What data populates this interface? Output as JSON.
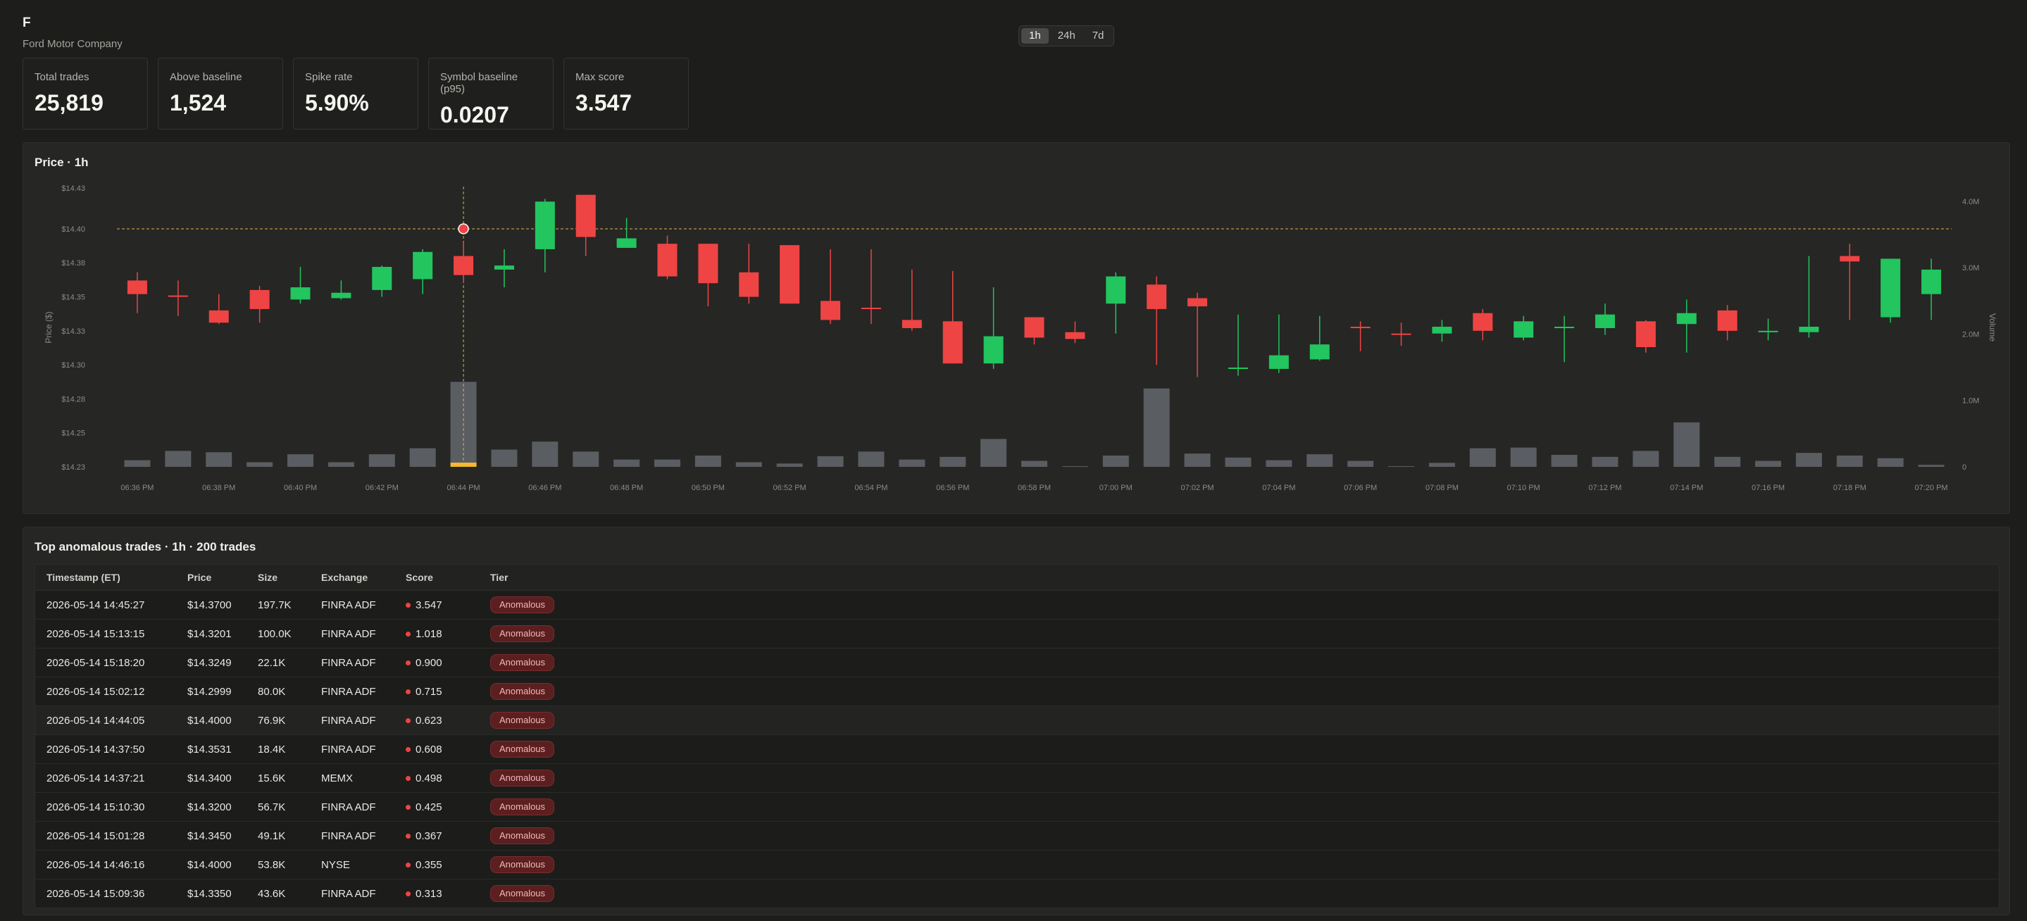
{
  "header": {
    "ticker": "F",
    "company": "Ford Motor Company"
  },
  "range_toggle": {
    "options": [
      "1h",
      "24h",
      "7d"
    ],
    "active": "1h"
  },
  "stats": [
    {
      "label": "Total trades",
      "value": "25,819"
    },
    {
      "label": "Above baseline",
      "value": "1,524"
    },
    {
      "label": "Spike rate",
      "value": "5.90%"
    },
    {
      "label": "Symbol baseline (p95)",
      "value": "0.0207"
    },
    {
      "label": "Max score",
      "value": "3.547"
    }
  ],
  "price_panel": {
    "title": "Price · 1h"
  },
  "table_panel": {
    "title": "Top anomalous trades · 1h · 200 trades"
  },
  "colors": {
    "up": "#22c55e",
    "down": "#ef4444",
    "volume": "#5a5d62",
    "highlight": "#f5b82e",
    "accent_line": "#e3b34a"
  },
  "chart_data": {
    "type": "candlestick",
    "ylabel": "Price ($)",
    "y2label": "Volume",
    "ylim": [
      14.225,
      14.43
    ],
    "y2lim": [
      0,
      4200000
    ],
    "y_ticks": [
      "$14.43",
      "$14.40",
      "$14.38",
      "$14.35",
      "$14.33",
      "$14.30",
      "$14.28",
      "$14.25",
      "$14.23"
    ],
    "y_tick_values": [
      14.43,
      14.4,
      14.375,
      14.35,
      14.325,
      14.3,
      14.275,
      14.25,
      14.225
    ],
    "y2_ticks": [
      "4.0M",
      "3.0M",
      "2.0M",
      "1.0M",
      "0"
    ],
    "y2_tick_values": [
      4000000,
      3000000,
      2000000,
      1000000,
      0
    ],
    "x_ticks": [
      "06:36 PM",
      "06:38 PM",
      "06:40 PM",
      "06:42 PM",
      "06:44 PM",
      "06:46 PM",
      "06:48 PM",
      "06:50 PM",
      "06:52 PM",
      "06:54 PM",
      "06:56 PM",
      "06:58 PM",
      "07:00 PM",
      "07:02 PM",
      "07:04 PM",
      "07:06 PM",
      "07:08 PM",
      "07:10 PM",
      "07:12 PM",
      "07:14 PM",
      "07:16 PM",
      "07:18 PM",
      "07:20 PM"
    ],
    "highlight_index": 8,
    "highlight_price": 14.4,
    "candles": [
      {
        "o": 14.362,
        "c": 14.352,
        "h": 14.368,
        "l": 14.338,
        "v": 100000
      },
      {
        "o": 14.351,
        "c": 14.35,
        "h": 14.362,
        "l": 14.336,
        "v": 240000
      },
      {
        "o": 14.34,
        "c": 14.331,
        "h": 14.352,
        "l": 14.33,
        "v": 220000
      },
      {
        "o": 14.355,
        "c": 14.341,
        "h": 14.358,
        "l": 14.331,
        "v": 70000
      },
      {
        "o": 14.348,
        "c": 14.357,
        "h": 14.372,
        "l": 14.345,
        "v": 190000
      },
      {
        "o": 14.349,
        "c": 14.353,
        "h": 14.362,
        "l": 14.348,
        "v": 70000
      },
      {
        "o": 14.355,
        "c": 14.372,
        "h": 14.373,
        "l": 14.35,
        "v": 190000
      },
      {
        "o": 14.363,
        "c": 14.383,
        "h": 14.385,
        "l": 14.352,
        "v": 280000
      },
      {
        "o": 14.38,
        "c": 14.366,
        "h": 14.39,
        "l": 14.36,
        "v": 1280000
      },
      {
        "o": 14.37,
        "c": 14.373,
        "h": 14.385,
        "l": 14.357,
        "v": 260000
      },
      {
        "o": 14.385,
        "c": 14.42,
        "h": 14.422,
        "l": 14.368,
        "v": 380000
      },
      {
        "o": 14.425,
        "c": 14.394,
        "h": 14.425,
        "l": 14.38,
        "v": 230000
      },
      {
        "o": 14.386,
        "c": 14.393,
        "h": 14.408,
        "l": 14.386,
        "v": 110000
      },
      {
        "o": 14.389,
        "c": 14.365,
        "h": 14.395,
        "l": 14.363,
        "v": 110000
      },
      {
        "o": 14.389,
        "c": 14.36,
        "h": 14.389,
        "l": 14.343,
        "v": 170000
      },
      {
        "o": 14.368,
        "c": 14.35,
        "h": 14.389,
        "l": 14.345,
        "v": 70000
      },
      {
        "o": 14.388,
        "c": 14.345,
        "h": 14.388,
        "l": 14.345,
        "v": 50000
      },
      {
        "o": 14.347,
        "c": 14.333,
        "h": 14.385,
        "l": 14.33,
        "v": 160000
      },
      {
        "o": 14.342,
        "c": 14.341,
        "h": 14.385,
        "l": 14.33,
        "v": 230000
      },
      {
        "o": 14.333,
        "c": 14.327,
        "h": 14.37,
        "l": 14.325,
        "v": 110000
      },
      {
        "o": 14.332,
        "c": 14.301,
        "h": 14.369,
        "l": 14.301,
        "v": 150000
      },
      {
        "o": 14.301,
        "c": 14.321,
        "h": 14.357,
        "l": 14.297,
        "v": 420000
      },
      {
        "o": 14.335,
        "c": 14.32,
        "h": 14.335,
        "l": 14.315,
        "v": 90000
      },
      {
        "o": 14.324,
        "c": 14.319,
        "h": 14.332,
        "l": 14.316,
        "v": 10000
      },
      {
        "o": 14.345,
        "c": 14.365,
        "h": 14.368,
        "l": 14.323,
        "v": 170000
      },
      {
        "o": 14.359,
        "c": 14.341,
        "h": 14.365,
        "l": 14.3,
        "v": 1180000
      },
      {
        "o": 14.349,
        "c": 14.343,
        "h": 14.353,
        "l": 14.291,
        "v": 200000
      },
      {
        "o": 14.298,
        "c": 14.298,
        "h": 14.337,
        "l": 14.292,
        "v": 140000
      },
      {
        "o": 14.297,
        "c": 14.307,
        "h": 14.337,
        "l": 14.294,
        "v": 100000
      },
      {
        "o": 14.304,
        "c": 14.315,
        "h": 14.336,
        "l": 14.303,
        "v": 190000
      },
      {
        "o": 14.328,
        "c": 14.327,
        "h": 14.332,
        "l": 14.31,
        "v": 90000
      },
      {
        "o": 14.323,
        "c": 14.322,
        "h": 14.331,
        "l": 14.314,
        "v": 10000
      },
      {
        "o": 14.323,
        "c": 14.328,
        "h": 14.333,
        "l": 14.317,
        "v": 60000
      },
      {
        "o": 14.338,
        "c": 14.325,
        "h": 14.341,
        "l": 14.318,
        "v": 280000
      },
      {
        "o": 14.32,
        "c": 14.332,
        "h": 14.336,
        "l": 14.318,
        "v": 290000
      },
      {
        "o": 14.327,
        "c": 14.328,
        "h": 14.336,
        "l": 14.302,
        "v": 180000
      },
      {
        "o": 14.327,
        "c": 14.337,
        "h": 14.345,
        "l": 14.322,
        "v": 150000
      },
      {
        "o": 14.332,
        "c": 14.313,
        "h": 14.333,
        "l": 14.309,
        "v": 240000
      },
      {
        "o": 14.33,
        "c": 14.338,
        "h": 14.348,
        "l": 14.309,
        "v": 670000
      },
      {
        "o": 14.34,
        "c": 14.325,
        "h": 14.344,
        "l": 14.318,
        "v": 150000
      },
      {
        "o": 14.324,
        "c": 14.325,
        "h": 14.334,
        "l": 14.318,
        "v": 90000
      },
      {
        "o": 14.324,
        "c": 14.328,
        "h": 14.38,
        "l": 14.32,
        "v": 210000
      },
      {
        "o": 14.38,
        "c": 14.376,
        "h": 14.389,
        "l": 14.333,
        "v": 170000
      },
      {
        "o": 14.335,
        "c": 14.378,
        "h": 14.378,
        "l": 14.331,
        "v": 130000
      },
      {
        "o": 14.352,
        "c": 14.37,
        "h": 14.378,
        "l": 14.333,
        "v": 30000
      }
    ]
  },
  "table": {
    "columns": [
      "Timestamp (ET)",
      "Price",
      "Size",
      "Exchange",
      "Score",
      "Tier"
    ],
    "rows": [
      [
        "2026-05-14 14:45:27",
        "$14.3700",
        "197.7K",
        "FINRA ADF",
        "3.547",
        "Anomalous"
      ],
      [
        "2026-05-14 15:13:15",
        "$14.3201",
        "100.0K",
        "FINRA ADF",
        "1.018",
        "Anomalous"
      ],
      [
        "2026-05-14 15:18:20",
        "$14.3249",
        "22.1K",
        "FINRA ADF",
        "0.900",
        "Anomalous"
      ],
      [
        "2026-05-14 15:02:12",
        "$14.2999",
        "80.0K",
        "FINRA ADF",
        "0.715",
        "Anomalous"
      ],
      [
        "2026-05-14 14:44:05",
        "$14.4000",
        "76.9K",
        "FINRA ADF",
        "0.623",
        "Anomalous"
      ],
      [
        "2026-05-14 14:37:50",
        "$14.3531",
        "18.4K",
        "FINRA ADF",
        "0.608",
        "Anomalous"
      ],
      [
        "2026-05-14 14:37:21",
        "$14.3400",
        "15.6K",
        "MEMX",
        "0.498",
        "Anomalous"
      ],
      [
        "2026-05-14 15:10:30",
        "$14.3200",
        "56.7K",
        "FINRA ADF",
        "0.425",
        "Anomalous"
      ],
      [
        "2026-05-14 15:01:28",
        "$14.3450",
        "49.1K",
        "FINRA ADF",
        "0.367",
        "Anomalous"
      ],
      [
        "2026-05-14 14:46:16",
        "$14.4000",
        "53.8K",
        "NYSE",
        "0.355",
        "Anomalous"
      ],
      [
        "2026-05-14 15:09:36",
        "$14.3350",
        "43.6K",
        "FINRA ADF",
        "0.313",
        "Anomalous"
      ]
    ]
  }
}
